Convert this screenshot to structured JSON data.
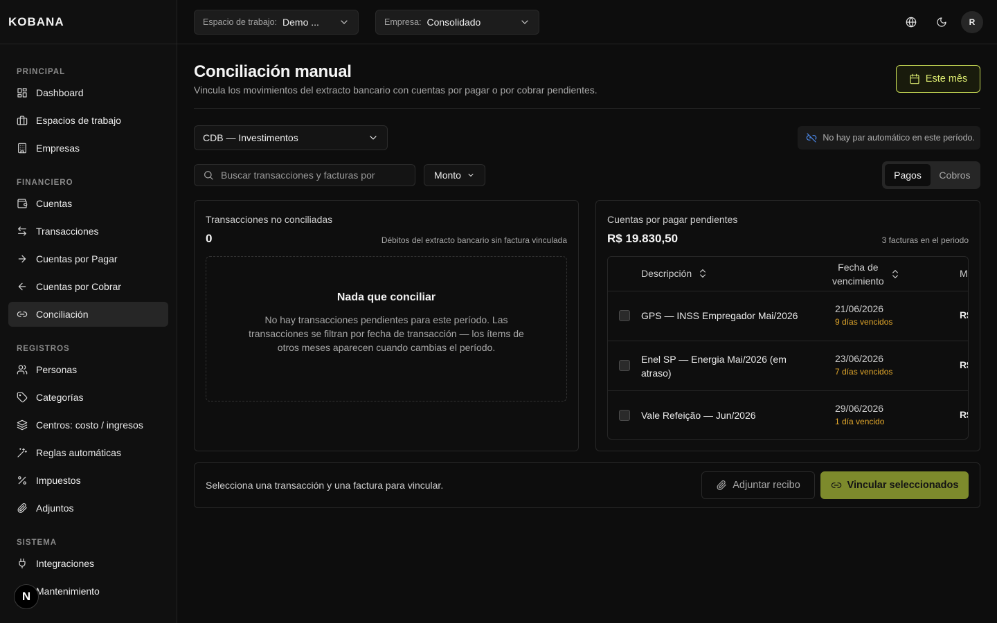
{
  "brand": {
    "logo": "KOBANA"
  },
  "sidebar": {
    "sections": [
      {
        "title": "PRINCIPAL",
        "items": [
          {
            "label": "Dashboard",
            "icon": "dashboard-icon"
          },
          {
            "label": "Espacios de trabajo",
            "icon": "briefcase-icon"
          },
          {
            "label": "Empresas",
            "icon": "building-icon"
          }
        ]
      },
      {
        "title": "FINANCIERO",
        "items": [
          {
            "label": "Cuentas",
            "icon": "wallet-icon"
          },
          {
            "label": "Transacciones",
            "icon": "arrows-left-right-icon"
          },
          {
            "label": "Cuentas por Pagar",
            "icon": "arrow-right-icon"
          },
          {
            "label": "Cuentas por Cobrar",
            "icon": "arrow-left-icon"
          },
          {
            "label": "Conciliación",
            "icon": "link-icon",
            "active": true
          }
        ]
      },
      {
        "title": "REGISTROS",
        "items": [
          {
            "label": "Personas",
            "icon": "users-icon"
          },
          {
            "label": "Categorías",
            "icon": "tag-icon"
          },
          {
            "label": "Centros: costo / ingresos",
            "icon": "layers-icon"
          },
          {
            "label": "Reglas automáticas",
            "icon": "wand-icon"
          },
          {
            "label": "Impuestos",
            "icon": "percent-icon"
          },
          {
            "label": "Adjuntos",
            "icon": "paperclip-icon"
          }
        ]
      },
      {
        "title": "SISTEMA",
        "items": [
          {
            "label": "Integraciones",
            "icon": "plug-icon"
          },
          {
            "label": "Mantenimiento",
            "icon": "wrench-icon"
          }
        ]
      }
    ],
    "badge": "N"
  },
  "topbar": {
    "workspace": {
      "label": "Espacio de trabajo:",
      "value": "Demo ..."
    },
    "company": {
      "label": "Empresa:",
      "value": "Consolidado"
    },
    "avatar": "R"
  },
  "page": {
    "title": "Conciliación manual",
    "subtitle": "Vincula los movimientos del extracto bancario con cuentas por pagar o por cobrar pendientes.",
    "period_button": "Este mês",
    "account": "CDB — Investimentos",
    "no_pair": "No hay par automático en este período.",
    "search_placeholder": "Buscar transacciones y facturas por",
    "sort_label": "Monto",
    "tabs": {
      "pay": "Pagos",
      "collect": "Cobros",
      "active": "Pagos"
    }
  },
  "left_panel": {
    "title": "Transacciones no conciliadas",
    "count": "0",
    "hint": "Débitos del extracto bancario sin factura vinculada",
    "empty_title": "Nada que conciliar",
    "empty_text": "No hay transacciones pendientes para este período. Las transacciones se filtran por fecha de transacción — los ítems de otros meses aparecen cuando cambias el período."
  },
  "right_panel": {
    "title": "Cuentas por pagar pendientes",
    "total": "R$ 19.830,50",
    "hint": "3 facturas en el periodo",
    "columns": {
      "description": "Descripción",
      "due_1": "Fecha de",
      "due_2": "vencimiento",
      "amount": "M"
    },
    "rows": [
      {
        "description": "GPS — INSS Empregador Mai/2026",
        "date": "21/06/2026",
        "overdue": "9 días vencidos",
        "amount": "R$"
      },
      {
        "description": "Enel SP — Energia Mai/2026 (em atraso)",
        "date": "23/06/2026",
        "overdue": "7 días vencidos",
        "amount": "R$"
      },
      {
        "description": "Vale Refeição — Jun/2026",
        "date": "29/06/2026",
        "overdue": "1 día vencido",
        "amount": "R$"
      }
    ]
  },
  "footer": {
    "message": "Selecciona una transacción y una factura para vincular.",
    "attach": "Adjuntar recibo",
    "link": "Vincular seleccionados"
  },
  "colors": {
    "accent": "#c9dc55",
    "accent_button": "#7d8a2c",
    "overdue": "#e2a72b",
    "info": "#4d8cf0"
  }
}
